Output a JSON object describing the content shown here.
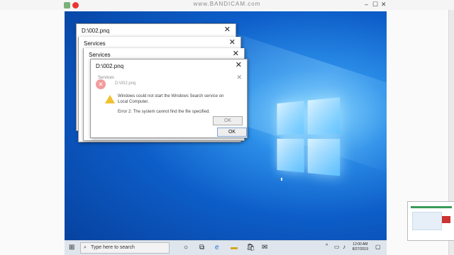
{
  "host": {
    "title": "www.BANDICAM.com"
  },
  "dialogs": {
    "file_title": "D:\\002.pnq",
    "services_title": "Services",
    "faded_file": "D:\\002.pnq",
    "overlap_line": "Windows could not start the Windows Search service on",
    "line2": "Local Computer.",
    "error_line": "Error 2: The system cannot find the file specified.",
    "ok_label": "OK",
    "close_glyph": "✕"
  },
  "taskbar": {
    "search_placeholder": "Type here to search",
    "clock_time": "12:00 AM",
    "clock_date": "8/27/2019"
  },
  "icons": [
    "start-icon",
    "search-icon",
    "cortana-icon",
    "task-view-icon",
    "edge-icon",
    "folder-icon",
    "store-icon",
    "mail-icon",
    "chevron-up-icon",
    "network-icon",
    "volume-icon",
    "notification-icon"
  ],
  "colors": {
    "desktop": "#0d5dc8",
    "taskbar": "#dfe5ec",
    "ok_border": "#7aa6d8"
  }
}
